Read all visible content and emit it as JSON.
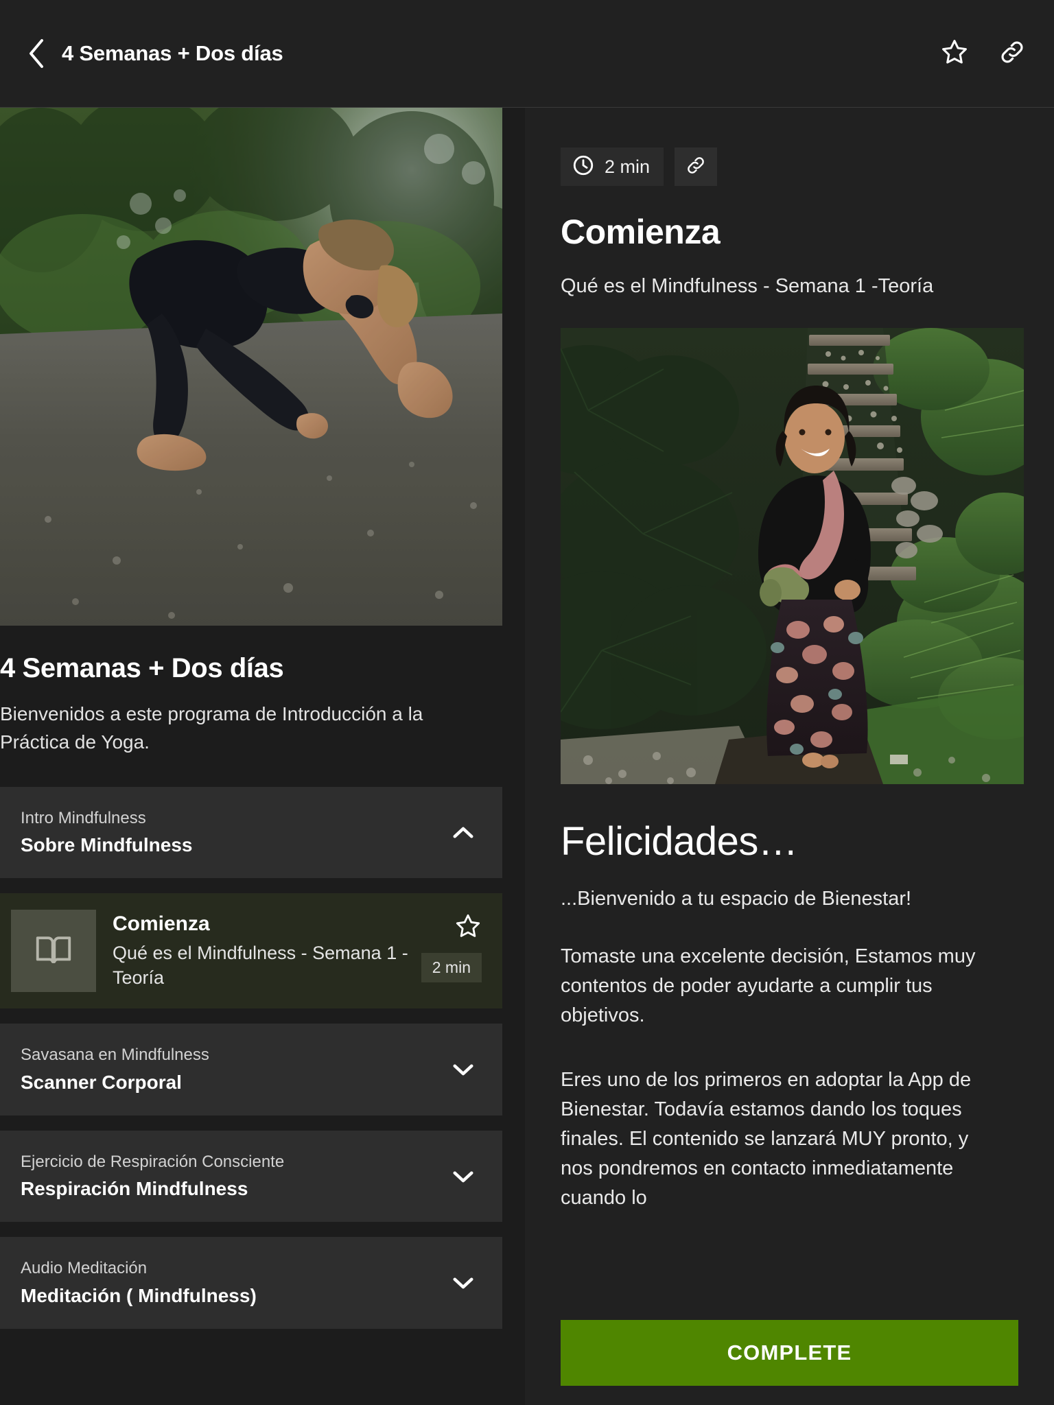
{
  "topbar": {
    "back_icon": "chevron-left-icon",
    "title": "4 Semanas + Dos días",
    "favorite_icon": "star-outline-icon",
    "share_icon": "link-icon"
  },
  "left": {
    "hero_image_alt": "woman in black yoga outfit doing a lizard pose on a gravel road in a green forest",
    "course_title": "4 Semanas + Dos días",
    "course_description": "Bienvenidos a este programa de Introducción a la Práctica de Yoga.",
    "sections": [
      {
        "subtitle": "Intro Mindfulness",
        "title": "Sobre Mindfulness",
        "expanded": true,
        "chevron": "chevron-up-icon"
      },
      {
        "subtitle": "Savasana en Mindfulness",
        "title": "Scanner Corporal",
        "expanded": false,
        "chevron": "chevron-down-icon"
      },
      {
        "subtitle": "Ejercicio de Respiración Consciente",
        "title": "Respiración Mindfulness",
        "expanded": false,
        "chevron": "chevron-down-icon"
      },
      {
        "subtitle": "Audio Meditación",
        "title": "Meditación ( Mindfulness)",
        "expanded": false,
        "chevron": "chevron-down-icon"
      }
    ],
    "lesson": {
      "thumb_icon": "book-open-icon",
      "title": "Comienza",
      "subtitle": "Qué es el Mindfulness - Semana 1 -Teoría",
      "favorite_icon": "star-outline-icon",
      "duration": "2 min",
      "selected": true
    }
  },
  "right": {
    "duration_icon": "clock-icon",
    "duration": "2 min",
    "share_icon": "link-icon",
    "title": "Comienza",
    "subtitle": "Qué es el Mindfulness - Semana 1 -Teoría",
    "content_image_alt": "smiling woman holding a rolled green yoga mat standing on a wooden path in a lush tropical garden with stone steps and ferns",
    "heading": "Felicidades…",
    "lead": "...Bienvenido a tu espacio de Bienestar!",
    "paragraph_1": "Tomaste una excelente decisión, Estamos muy contentos de poder ayudarte a cumplir tus objetivos.",
    "paragraph_2": "Eres uno de los primeros en adoptar la App de Bienestar. Todavía estamos dando los toques finales. El contenido se lanzará MUY pronto, y nos pondremos en contacto inmediatamente cuando lo",
    "complete_label": "COMPLETE"
  },
  "colors": {
    "background": "#1c1c1c",
    "panel": "#212121",
    "card": "#2e2e2e",
    "selected_row": "#272b1e",
    "accent_green": "#4f8600",
    "text_primary": "#ffffff",
    "text_secondary": "#e2e2e2"
  }
}
